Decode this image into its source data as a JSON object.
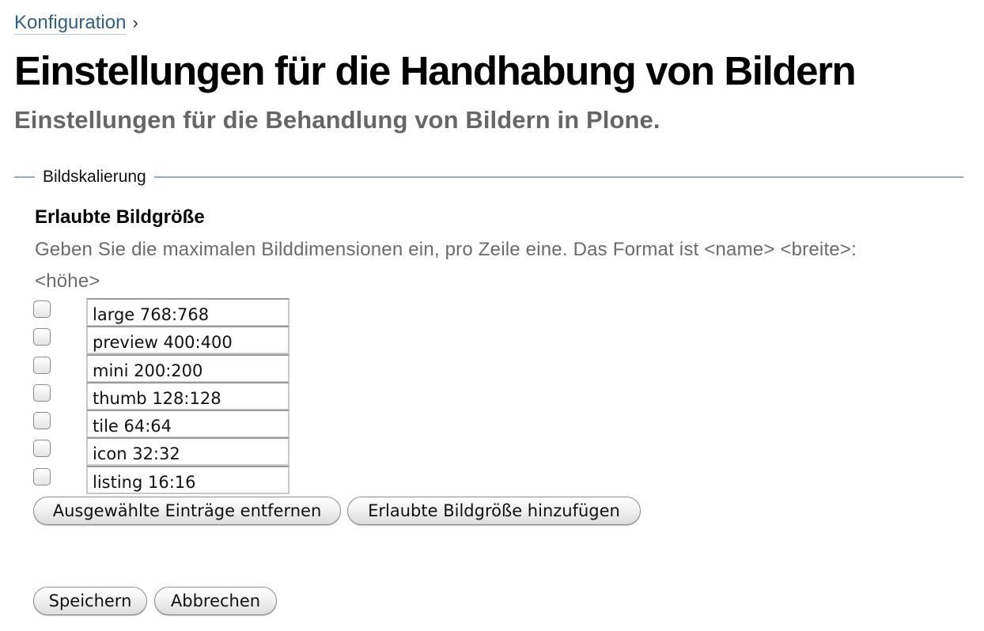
{
  "breadcrumb": {
    "parent_label": "Konfiguration",
    "separator": "›"
  },
  "page": {
    "title": "Einstellungen für die Handhabung von Bildern",
    "description": "Einstellungen für die Behandlung von Bildern in Plone."
  },
  "fieldset": {
    "legend": "Bildskalierung"
  },
  "field": {
    "label": "Erlaubte Bildgröße",
    "help": "Geben Sie die maximalen Bilddimensionen ein, pro Zeile eine. Das Format ist <name> <breite>:<höhe>"
  },
  "sizes": [
    {
      "value": "large 768:768",
      "checked": false
    },
    {
      "value": "preview 400:400",
      "checked": false
    },
    {
      "value": "mini 200:200",
      "checked": false
    },
    {
      "value": "thumb 128:128",
      "checked": false
    },
    {
      "value": "tile 64:64",
      "checked": false
    },
    {
      "value": "icon 32:32",
      "checked": false
    },
    {
      "value": "listing 16:16",
      "checked": false
    }
  ],
  "buttons": {
    "remove_selected": "Ausgewählte Einträge entfernen",
    "add_size": "Erlaubte Bildgröße hinzufügen",
    "save": "Speichern",
    "cancel": "Abbrechen"
  }
}
